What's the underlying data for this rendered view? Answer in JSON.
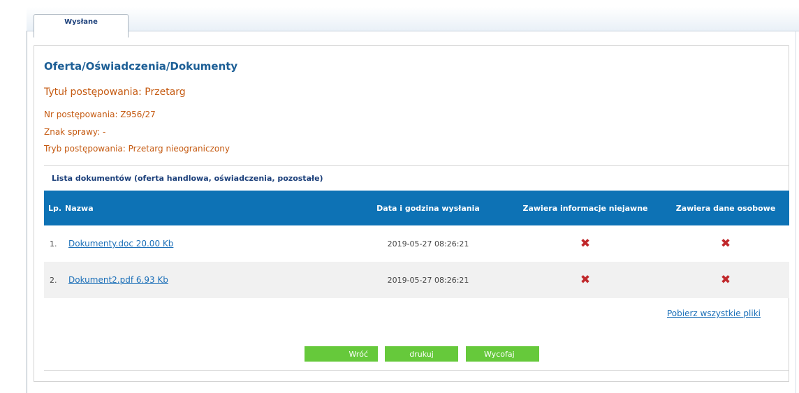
{
  "tabs": [
    {
      "label": "Wysłane",
      "active": true
    }
  ],
  "header": {
    "title": "Oferta/Oświadczenia/Dokumenty",
    "proceeding_title": "Tytuł postępowania: Przetarg",
    "proceeding_number": "Nr postępowania: Z956/27",
    "case_mark": "Znak sprawy: -",
    "proceeding_mode": "Tryb postępowania: Przetarg nieograniczony"
  },
  "documents": {
    "list_title": "Lista dokumentów (oferta handlowa, oświadczenia, pozostałe)",
    "columns": {
      "lp": "Lp.",
      "name": "Nazwa",
      "date": "Data i godzina wysłania",
      "classified": "Zawiera informacje niejawne",
      "personal": "Zawiera dane osobowe"
    },
    "rows": [
      {
        "lp": "1.",
        "name": "Dokumenty.doc 20.00 Kb",
        "date": "2019-05-27 08:26:21",
        "classified": false,
        "personal": false
      },
      {
        "lp": "2.",
        "name": "Dokument2.pdf 6.93 Kb",
        "date": "2019-05-27 08:26:21",
        "classified": false,
        "personal": false
      }
    ],
    "download_all": "Pobierz wszystkie pliki"
  },
  "buttons": {
    "back": "Wróć",
    "print": "drukuj",
    "withdraw": "Wycofaj"
  },
  "colors": {
    "table_header": "#0d72b5",
    "button_green": "#66c93b",
    "x_mark": "#c0282b",
    "title_blue": "#1d5f96",
    "info_orange": "#c55a11"
  },
  "icons": {
    "no_mark": "✖"
  }
}
